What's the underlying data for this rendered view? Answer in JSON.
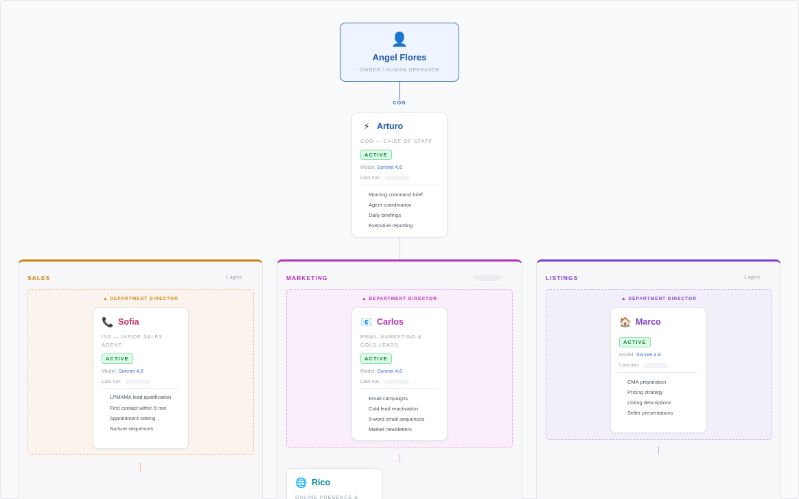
{
  "owner": {
    "icon": "person-icon",
    "emoji": "👤",
    "name": "Angel Flores",
    "role": "OWNER / HUMAN OPERATOR"
  },
  "coo_tag": "COO",
  "coo": {
    "emoji": "⚡",
    "name": "Arturo",
    "role": "COO — CHIEF OF STAFF",
    "status": "ACTIVE",
    "model_label": "Model:",
    "model": "Sonnet 4.6",
    "last_run_label": "Last run:",
    "tasks": [
      "Morning command brief",
      "Agent coordination",
      "Daily briefings",
      "Executive reporting"
    ]
  },
  "director_label": "▲ DEPARTMENT DIRECTOR",
  "departments": [
    {
      "title": "SALES",
      "count": "1 agent",
      "color": "#c9850a",
      "agent": {
        "emoji": "📞",
        "name": "Sofia",
        "name_color": "#c9306a",
        "role": "ISA — INSIDE SALES AGENT",
        "status": "ACTIVE",
        "model_label": "Model:",
        "model": "Sonnet 4.6",
        "last_run_label": "Last run:",
        "tasks": [
          "LPMAMA lead qualification",
          "First contact within 5 min",
          "Appointment setting",
          "Nurture sequences"
        ]
      }
    },
    {
      "title": "MARKETING",
      "count": "",
      "color": "#b52fb5",
      "agent": {
        "emoji": "📧",
        "name": "Carlos",
        "name_color": "#b52fb5",
        "role": "EMAIL MARKETING & COLD LEADS",
        "status": "ACTIVE",
        "model_label": "Model:",
        "model": "Sonnet 4.6",
        "last_run_label": "Last run:",
        "tasks": [
          "Email campaigns",
          "Cold lead reactivation",
          "9-word email sequences",
          "Market newsletters"
        ]
      },
      "sub_agent": {
        "emoji": "🌐",
        "name": "Rico",
        "name_color": "#0e8f9a",
        "role": "ONLINE PRESENCE &"
      }
    },
    {
      "title": "LISTINGS",
      "count": "1 agent",
      "color": "#7b3fd0",
      "agent": {
        "emoji": "🏠",
        "name": "Marco",
        "name_color": "#7b3fd0",
        "role": "",
        "status": "ACTIVE",
        "model_label": "Model:",
        "model": "Sonnet 4.6",
        "last_run_label": "Last run:",
        "tasks": [
          "CMA preparation",
          "Pricing strategy",
          "Listing descriptions",
          "Seller presentations"
        ]
      }
    }
  ]
}
